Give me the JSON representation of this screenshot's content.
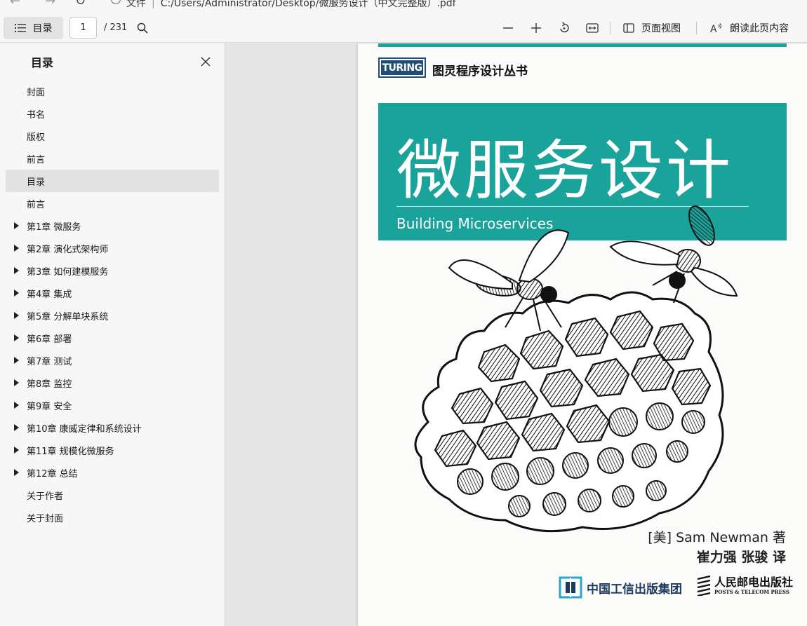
{
  "address_bar": {
    "file_label": "文件",
    "path": "C:/Users/Administrator/Desktop/微服务设计（中文完整版）.pdf"
  },
  "toolbar": {
    "toc_label": "目录",
    "current_page": "1",
    "total_pages": "/ 231",
    "page_view_label": "页面视图",
    "read_aloud_label": "朗读此页内容"
  },
  "sidebar": {
    "title": "目录",
    "items": [
      {
        "label": "封面",
        "expandable": false,
        "selected": false
      },
      {
        "label": "书名",
        "expandable": false,
        "selected": false
      },
      {
        "label": "版权",
        "expandable": false,
        "selected": false
      },
      {
        "label": "前言",
        "expandable": false,
        "selected": false
      },
      {
        "label": "目录",
        "expandable": false,
        "selected": true
      },
      {
        "label": "前言",
        "expandable": false,
        "selected": false
      },
      {
        "label": "第1章 微服务",
        "expandable": true,
        "selected": false
      },
      {
        "label": "第2章 演化式架构师",
        "expandable": true,
        "selected": false
      },
      {
        "label": "第3章 如何建模服务",
        "expandable": true,
        "selected": false
      },
      {
        "label": "第4章 集成",
        "expandable": true,
        "selected": false
      },
      {
        "label": "第5章 分解单块系统",
        "expandable": true,
        "selected": false
      },
      {
        "label": "第6章 部署",
        "expandable": true,
        "selected": false
      },
      {
        "label": "第7章 测试",
        "expandable": true,
        "selected": false
      },
      {
        "label": "第8章 监控",
        "expandable": true,
        "selected": false
      },
      {
        "label": "第9章 安全",
        "expandable": true,
        "selected": false
      },
      {
        "label": "第10章 康威定律和系统设计",
        "expandable": true,
        "selected": false
      },
      {
        "label": "第11章 规模化微服务",
        "expandable": true,
        "selected": false
      },
      {
        "label": "第12章 总结",
        "expandable": true,
        "selected": false
      },
      {
        "label": "关于作者",
        "expandable": false,
        "selected": false
      },
      {
        "label": "关于封面",
        "expandable": false,
        "selected": false
      }
    ]
  },
  "cover": {
    "logo_text": "TURING",
    "series": "图灵程序设计丛书",
    "title": "微服务设计",
    "subtitle": "Building Microservices",
    "author": "[美] Sam Newman 著",
    "translators": "崔力强 张骏 译",
    "publisher_1": "中国工信出版集团",
    "publisher_2_cn": "人民邮电出版社",
    "publisher_2_en": "POSTS & TELECOM PRESS"
  },
  "colors": {
    "cover_teal": "#1aa39b",
    "toolbar_bg": "#f7f7f7",
    "selected_bg": "#e2e2e2",
    "logo_navy": "#1f4d78"
  }
}
